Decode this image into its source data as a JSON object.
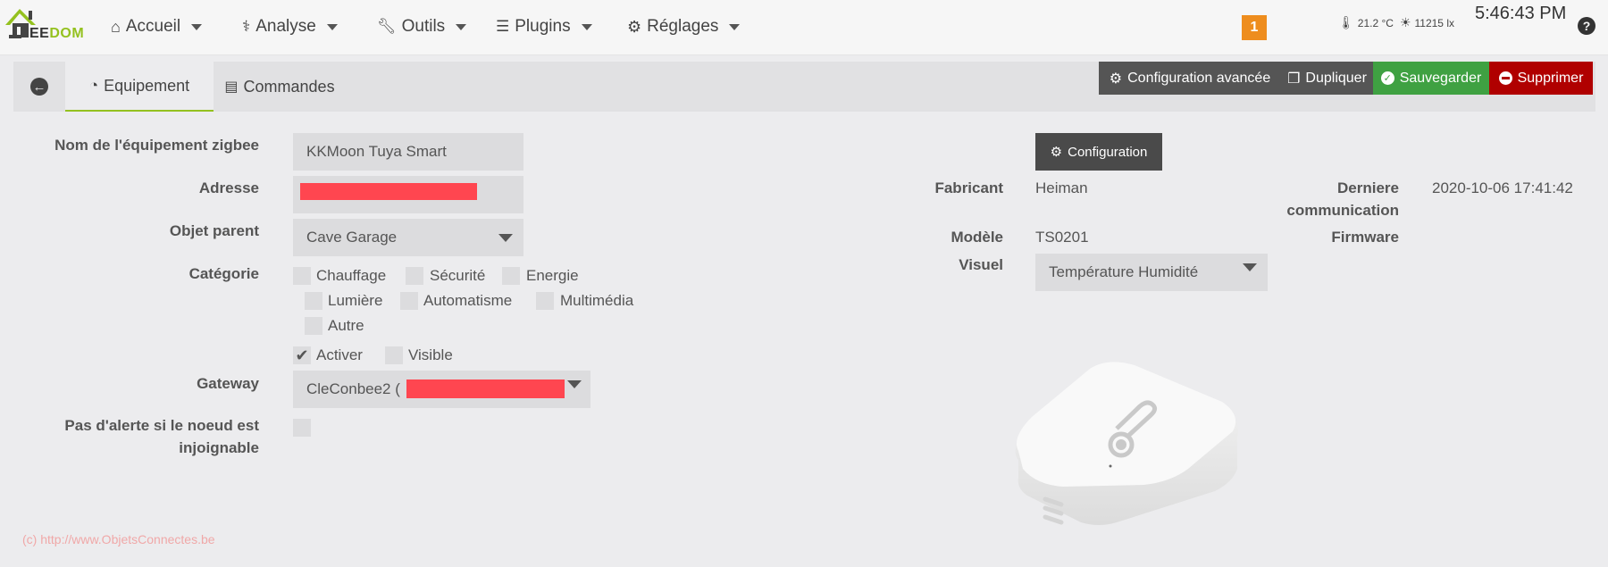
{
  "header": {
    "logo_text": "EEDOM",
    "nav": [
      {
        "label": "Accueil",
        "icon": "home-icon"
      },
      {
        "label": "Analyse",
        "icon": "stethoscope-icon"
      },
      {
        "label": "Outils",
        "icon": "wrench-icon"
      },
      {
        "label": "Plugins",
        "icon": "tasks-list-icon"
      },
      {
        "label": "Réglages",
        "icon": "gear-icon"
      }
    ],
    "notification_count": "1",
    "temperature": "21.2 °C",
    "luminosity": "11215 lx",
    "clock": "5:46:43 PM",
    "help_label": "?"
  },
  "tabs": [
    {
      "label": "Equipement",
      "icon": "dashboard-icon",
      "active": true
    },
    {
      "label": "Commandes",
      "icon": "list-icon",
      "active": false
    }
  ],
  "actions": {
    "advanced_config": "Configuration avancée",
    "duplicate": "Dupliquer",
    "save": "Sauvegarder",
    "delete": "Supprimer",
    "colors": {
      "dark": "#555555",
      "save": "#3fa142",
      "delete": "#b00000"
    }
  },
  "form": {
    "name_label": "Nom de l'équipement zigbee",
    "name_value": "KKMoon Tuya Smart",
    "address_label": "Adresse",
    "address_value": "[redacted]",
    "parent_label": "Objet parent",
    "parent_value": "Cave Garage",
    "category_label": "Catégorie",
    "categories": [
      {
        "label": "Chauffage",
        "checked": false
      },
      {
        "label": "Sécurité",
        "checked": false
      },
      {
        "label": "Energie",
        "checked": false
      },
      {
        "label": "Lumière",
        "checked": false
      },
      {
        "label": "Automatisme",
        "checked": false
      },
      {
        "label": "Multimédia",
        "checked": false
      },
      {
        "label": "Autre",
        "checked": false
      }
    ],
    "enable_label": "Activer",
    "enable_checked": true,
    "visible_label": "Visible",
    "visible_checked": false,
    "gateway_label": "Gateway",
    "gateway_value": "CleConbee2 (",
    "no_alert_label_1": "Pas d'alerte si le noeud est",
    "no_alert_label_2": "injoignable",
    "no_alert_checked": false
  },
  "info": {
    "config_button": "Configuration",
    "manufacturer_label": "Fabricant",
    "manufacturer_value": "Heiman",
    "last_comm_label_1": "Derniere",
    "last_comm_label_2": "communication",
    "last_comm_value": "2020-10-06 17:41:42",
    "model_label": "Modèle",
    "model_value": "TS0201",
    "firmware_label": "Firmware",
    "firmware_value": "",
    "visual_label": "Visuel",
    "visual_value": "Température Humidité"
  },
  "watermark": "(c) http://www.ObjetsConnectes.be"
}
